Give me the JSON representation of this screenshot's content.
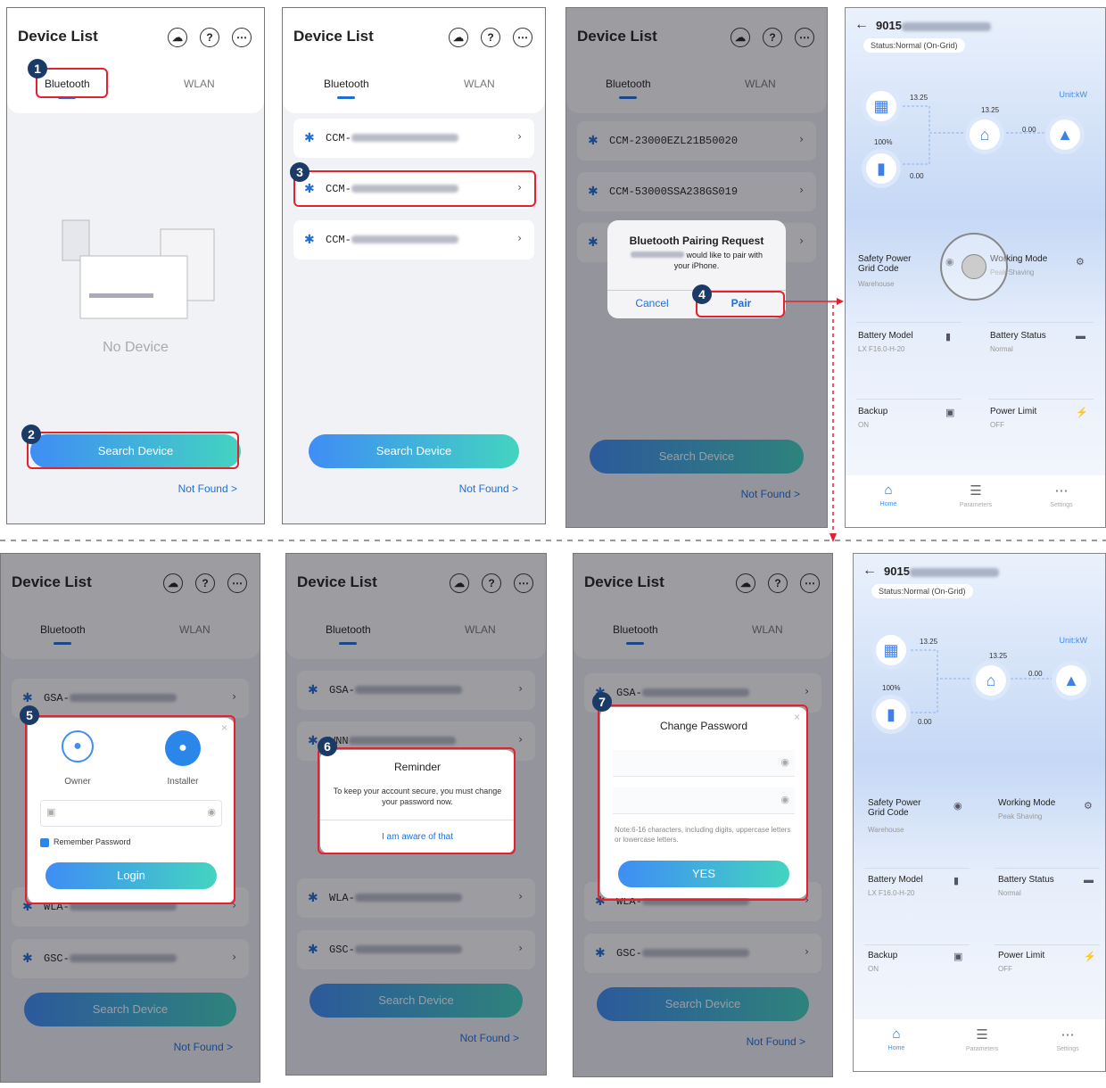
{
  "list_screen": {
    "title": "Device List",
    "tab_bluetooth": "Bluetooth",
    "tab_wlan": "WLAN",
    "no_device": "No Device",
    "search_button": "Search Device",
    "not_found": "Not Found >"
  },
  "steps": [
    "1",
    "2",
    "3",
    "4",
    "5",
    "6",
    "7"
  ],
  "panel2_devices": [
    "CCM-",
    "CCM-",
    "CCM-"
  ],
  "panel3_devices": [
    "CCM-23000EZL21B50020",
    "CCM-53000SSA238GS019",
    ""
  ],
  "pairing": {
    "title": "Bluetooth Pairing Request",
    "body_pre": "",
    "body": "would like to pair with your iPhone.",
    "cancel": "Cancel",
    "pair": "Pair"
  },
  "panel5_devices": [
    "GSA-",
    "WLA-",
    "GSC-"
  ],
  "login": {
    "owner": "Owner",
    "installer": "Installer",
    "remember": "Remember Password",
    "login_button": "Login"
  },
  "panel6_devices": [
    "GSA-",
    "WNN",
    "WLA-",
    "GSC-"
  ],
  "reminder": {
    "title": "Reminder",
    "body": "To keep your account secure, you must change your password  now.",
    "action": "I am aware of that"
  },
  "panel7_devices": [
    "GSA-",
    "WLA-",
    "GSC-"
  ],
  "change_password": {
    "title": "Change Password",
    "note": "Note:6-16 characters, including digits, uppercase letters or lowercase letters.",
    "yes": "YES"
  },
  "home": {
    "serial_prefix": "9015",
    "status": "Status:Normal (On-Grid)",
    "unit": "Unit:kW",
    "pv_power": "13.25",
    "home_power": "13.25",
    "grid_power": "0.00",
    "battery_soc": "100%",
    "battery_power": "0.00",
    "cards": [
      {
        "title": "Safety Power Grid Code",
        "sub": "Warehouse",
        "icon": "shield-icon"
      },
      {
        "title": "Working Mode",
        "sub": "Peak Shaving",
        "icon": "gear-icon"
      },
      {
        "title": "Battery Model",
        "sub": "LX F16.0-H-20",
        "icon": "battery-icon"
      },
      {
        "title": "Battery Status",
        "sub": "Normal",
        "icon": "battery-status-icon"
      },
      {
        "title": "Backup",
        "sub": "ON",
        "icon": "backup-icon"
      },
      {
        "title": "Power Limit",
        "sub": "OFF",
        "icon": "power-limit-icon"
      }
    ],
    "nav": [
      "Home",
      "Parameters",
      "Settings"
    ]
  }
}
